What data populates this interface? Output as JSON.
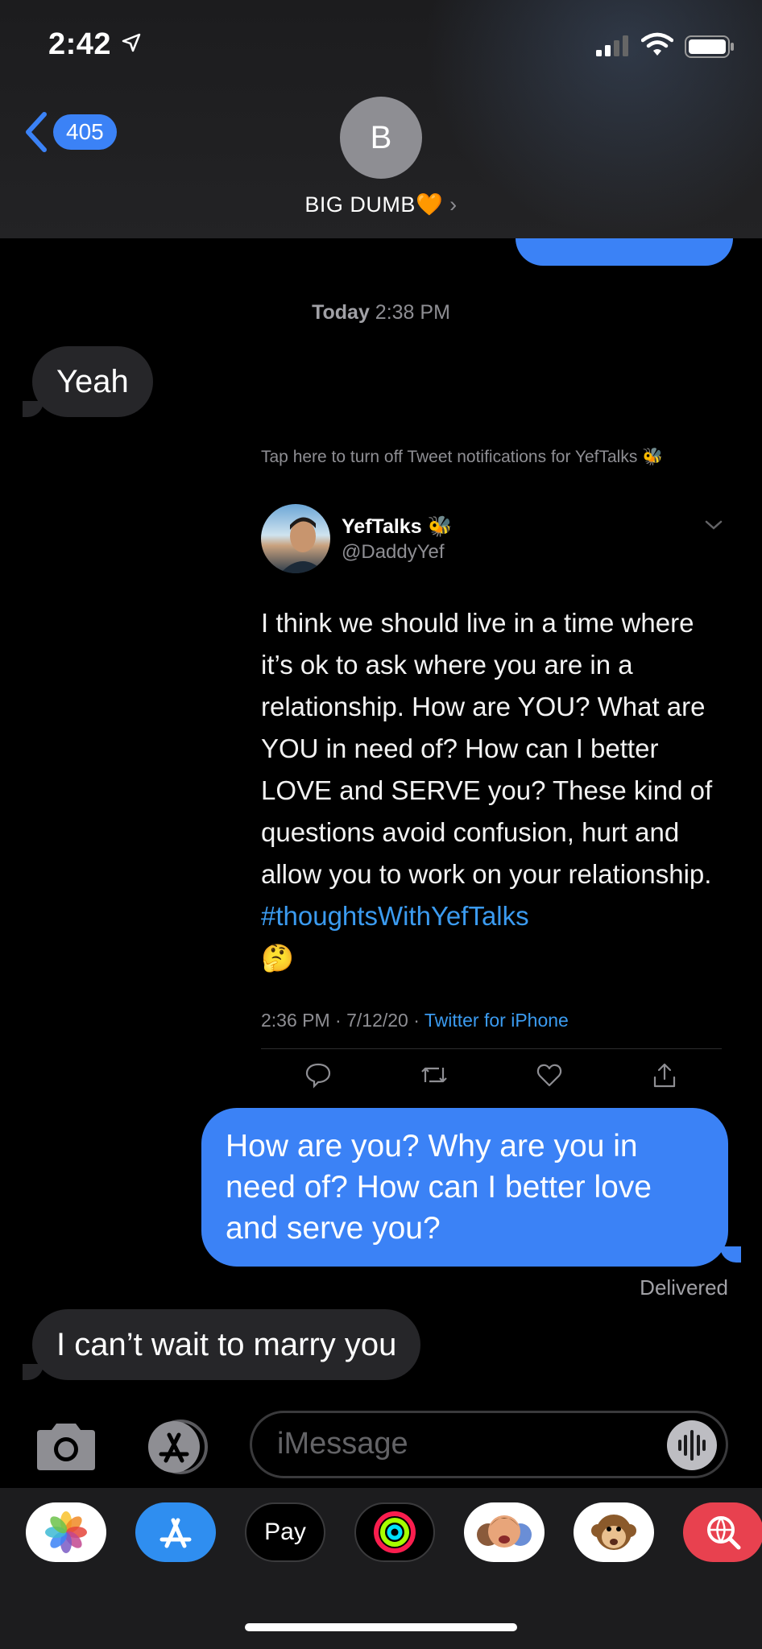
{
  "status_bar": {
    "time": "2:42"
  },
  "header": {
    "back_count": "405",
    "avatar_initial": "B",
    "contact_name": "BIG DUMB",
    "contact_emoji": "🧡"
  },
  "conversation": {
    "timestamp_day": "Today",
    "timestamp_time": "2:38 PM",
    "messages": [
      {
        "dir": "in",
        "text": "Yeah"
      },
      {
        "dir": "out",
        "text": "How are you? Why are you in need of? How can I better love and serve you?"
      },
      {
        "dir": "in",
        "text": "I can’t wait to marry you"
      }
    ],
    "delivered": "Delivered"
  },
  "tweet": {
    "notice": "Tap here to turn off Tweet notifications for YefTalks 🐝",
    "name": "YefTalks 🐝",
    "handle": "@DaddyYef",
    "text": "I think we should live in a time where it’s ok to ask where you are in a relationship. How are YOU? What are YOU in need of? How can I better LOVE and SERVE you? These kind of questions avoid confusion, hurt and allow you to work on your relationship. ",
    "hashtag": "#thoughtsWithYefTalks",
    "emoji": "🤔",
    "meta": "2:36 PM · 7/12/20 · ",
    "source": "Twitter for iPhone"
  },
  "input": {
    "placeholder": "iMessage"
  },
  "apps": {
    "items": [
      "photos",
      "app-store",
      "apple-pay",
      "activity",
      "memoji",
      "animoji",
      "web-search"
    ],
    "applepay_label": "Pay"
  },
  "colors": {
    "accent": "#3b82f6",
    "incoming_bubble": "#262629",
    "link": "#3b9bf0"
  }
}
